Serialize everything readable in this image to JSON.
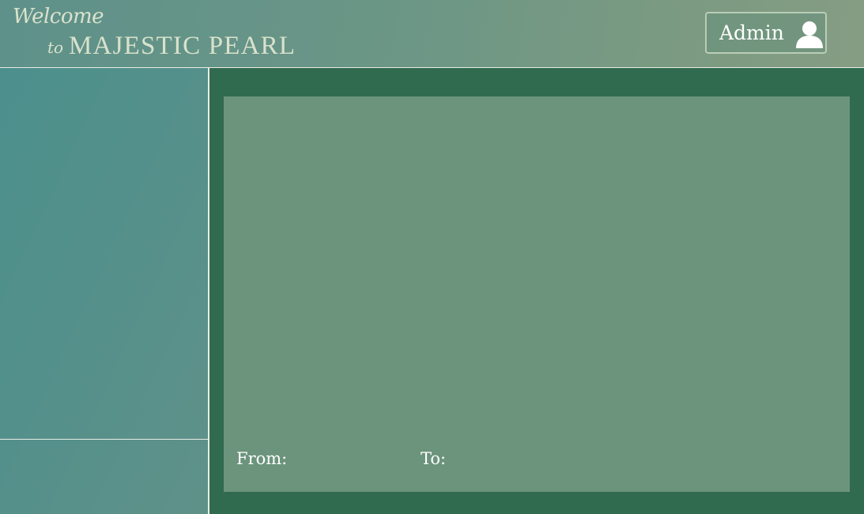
{
  "header": {
    "brand_welcome": "Welcome",
    "brand_to": "to",
    "brand_name": "MAJESTIC PEARL",
    "user_button_label": "Admin",
    "user_icon": "user-icon"
  },
  "sidebar": {
    "top_panel": "",
    "bottom_panel": ""
  },
  "main": {
    "from_label": "From:",
    "from_value": "",
    "to_label": "To:",
    "to_value": ""
  },
  "colors": {
    "header_gradient_start": "#5e918a",
    "header_gradient_end": "#859d83",
    "main_frame": "#316b4f",
    "content_panel": "#6c947d",
    "brand_text": "#d9e2cc",
    "divider": "#e8ece4"
  }
}
